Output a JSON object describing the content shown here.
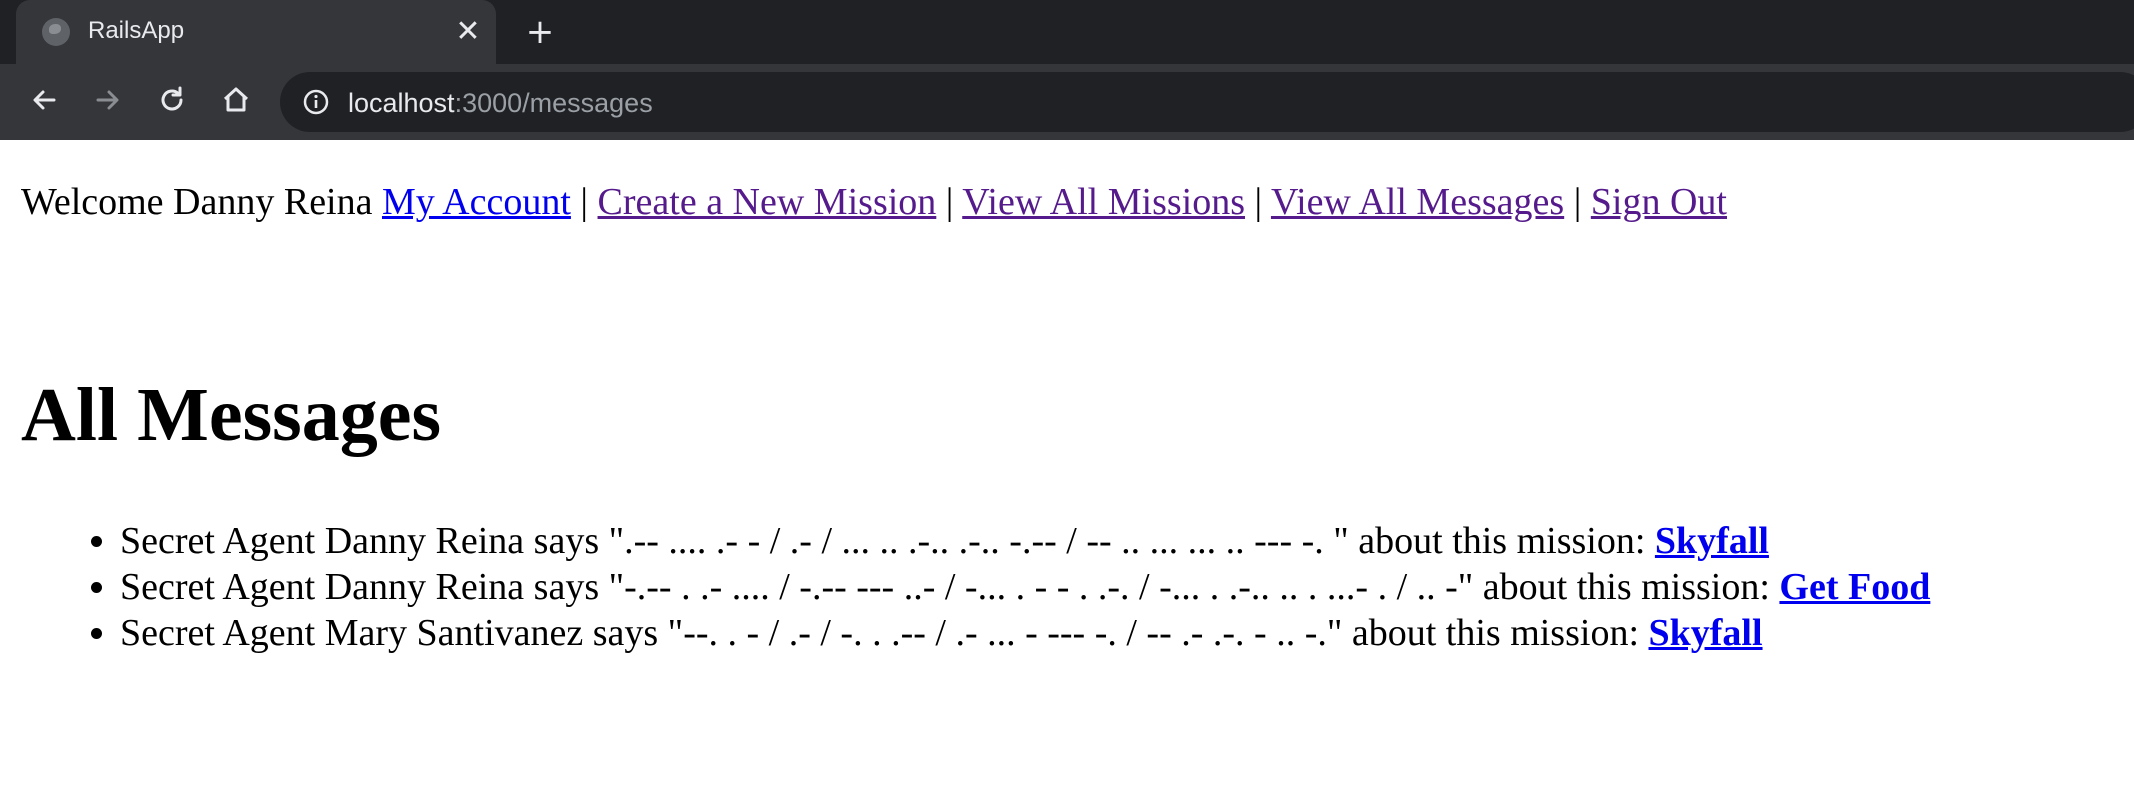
{
  "browser": {
    "tab_title": "RailsApp",
    "url_host": "localhost",
    "url_path": ":3000/messages",
    "icons": [
      "globe-icon",
      "close-icon",
      "plus-icon",
      "back-arrow-icon",
      "forward-arrow-icon",
      "reload-icon",
      "home-icon",
      "info-icon"
    ]
  },
  "nav": {
    "welcome": "Welcome Danny Reina",
    "my_account": "My Account",
    "create_mission": "Create a New Mission",
    "view_missions": "View All Missions",
    "view_messages": "View All Messages",
    "sign_out": "Sign Out",
    "separator": "|"
  },
  "main": {
    "title": "All Messages",
    "messages": [
      {
        "text": "Secret Agent Danny Reina says \".-- .... .- - / .- / ... .. .-.. .-.. -.-- / -- .. ... ... .. --- -. \" about this mission: ",
        "mission": "Skyfall"
      },
      {
        "text": "Secret Agent Danny Reina says \"-.-- . .- .... / -.-- --- ..- / -... . - - . .-. / -... . .-.. .. . ...- . / .. -\" about this mission: ",
        "mission": "Get Food"
      },
      {
        "text": "Secret Agent Mary Santivanez says \"--. . - / .- / -. . .-- / .- ... - --- -. / -- .- .-. - .. -.\" about this mission: ",
        "mission": "Skyfall"
      }
    ]
  },
  "colors": {
    "link": "#0000ee",
    "visited_link": "#551a8b",
    "chrome_dark": "#202124",
    "chrome_toolbar": "#35363a"
  }
}
